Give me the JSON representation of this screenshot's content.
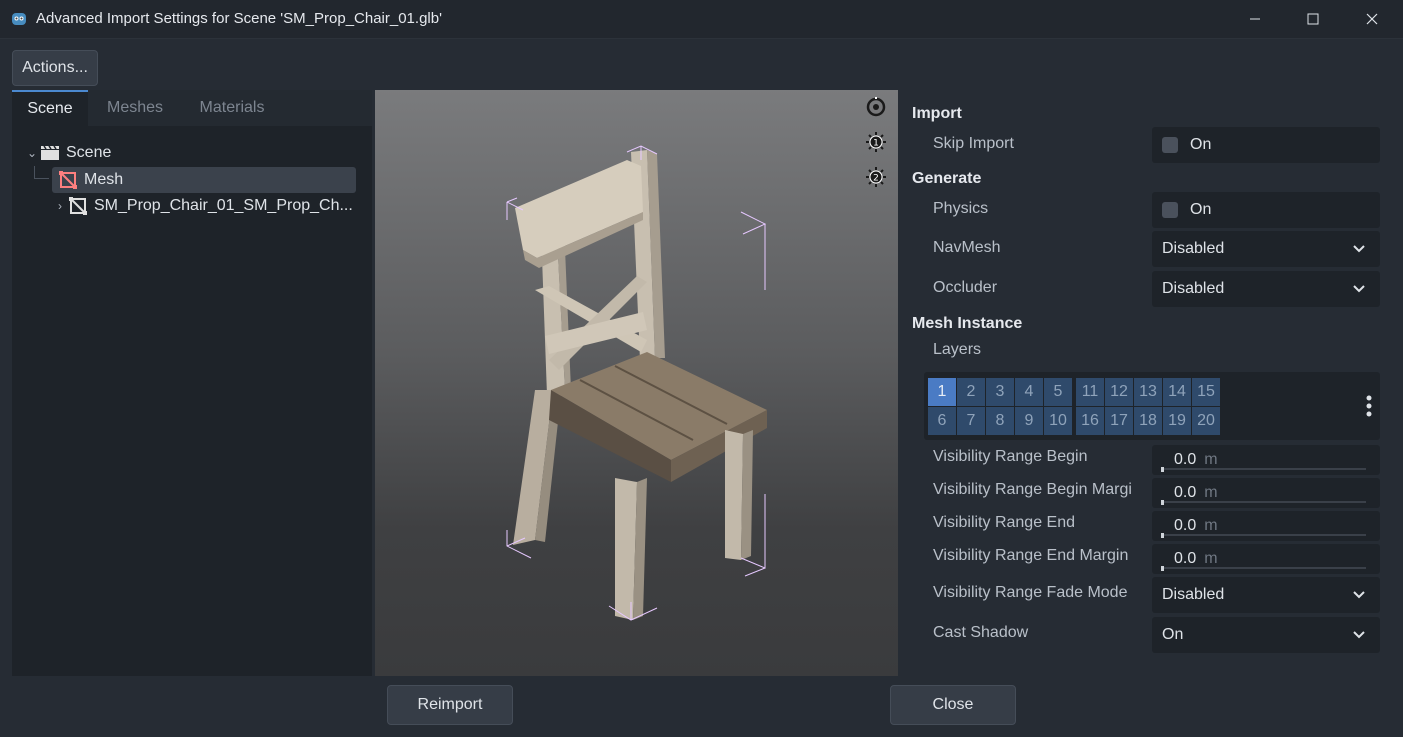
{
  "window": {
    "title": "Advanced Import Settings for Scene 'SM_Prop_Chair_01.glb'"
  },
  "toolbar": {
    "actions_label": "Actions..."
  },
  "tabs": [
    {
      "label": "Scene",
      "active": true
    },
    {
      "label": "Meshes",
      "active": false
    },
    {
      "label": "Materials",
      "active": false
    }
  ],
  "tree": [
    {
      "label": "Scene",
      "icon": "clapperboard-icon",
      "expanded": true
    },
    {
      "label": "Mesh",
      "icon": "mesh-icon",
      "expanded": true,
      "selected": true
    },
    {
      "label": "SM_Prop_Chair_01_SM_Prop_Ch...",
      "icon": "mesh-node-icon",
      "expanded": false
    }
  ],
  "viewport": {
    "icons": [
      "rotate-view-icon",
      "light-1-icon",
      "light-2-icon"
    ]
  },
  "inspector": {
    "import": {
      "header": "Import",
      "skip_import": {
        "label": "Skip Import",
        "value": "On",
        "checked": false
      }
    },
    "generate": {
      "header": "Generate",
      "physics": {
        "label": "Physics",
        "value": "On",
        "checked": false
      },
      "navmesh": {
        "label": "NavMesh",
        "value": "Disabled"
      },
      "occluder": {
        "label": "Occluder",
        "value": "Disabled"
      }
    },
    "mesh_instance": {
      "header": "Mesh Instance",
      "layers_label": "Layers",
      "layers_row1": [
        "1",
        "2",
        "3",
        "4",
        "5",
        "11",
        "12",
        "13",
        "14",
        "15"
      ],
      "layers_row2": [
        "6",
        "7",
        "8",
        "9",
        "10",
        "16",
        "17",
        "18",
        "19",
        "20"
      ],
      "active_layer": "1",
      "vis_begin": {
        "label": "Visibility Range Begin",
        "value": "0.0",
        "unit": "m"
      },
      "vis_begin_margin": {
        "label": "Visibility Range Begin Margi",
        "value": "0.0",
        "unit": "m"
      },
      "vis_end": {
        "label": "Visibility Range End",
        "value": "0.0",
        "unit": "m"
      },
      "vis_end_margin": {
        "label": "Visibility Range End Margin",
        "value": "0.0",
        "unit": "m"
      },
      "fade_mode": {
        "label": "Visibility Range Fade Mode",
        "value": "Disabled"
      },
      "cast_shadow": {
        "label": "Cast Shadow",
        "value": "On"
      }
    }
  },
  "footer": {
    "reimport_label": "Reimport",
    "close_label": "Close"
  },
  "colors": {
    "accent": "#4b89d0",
    "layer_active": "#4a7bc4",
    "layer_inactive": "#2f4a6b",
    "selection": "#3b424c"
  }
}
